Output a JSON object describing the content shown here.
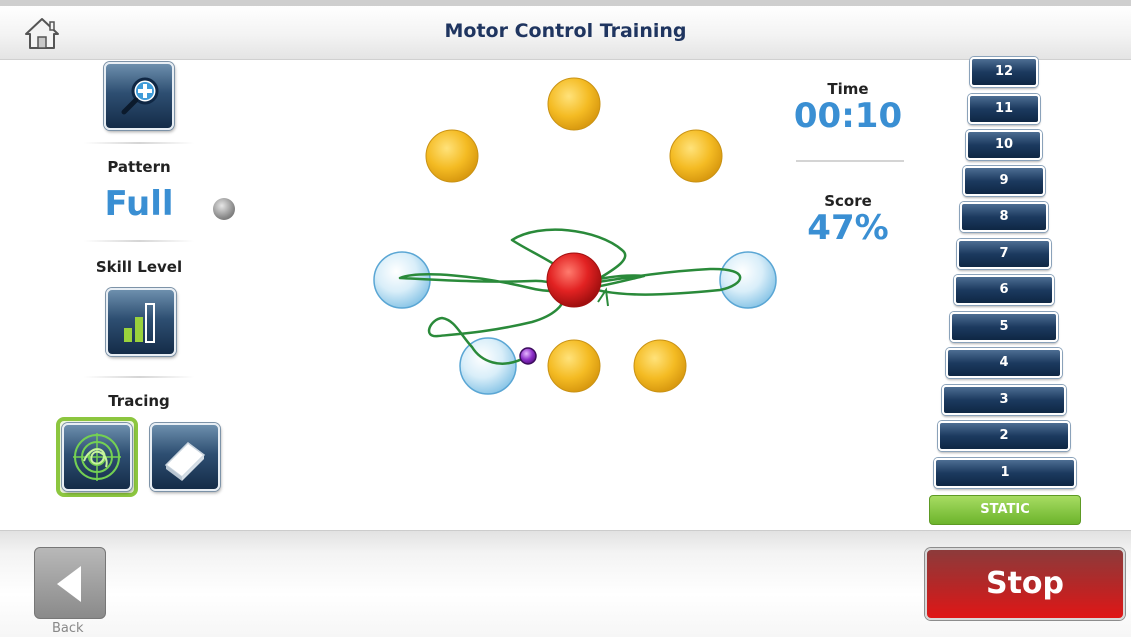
{
  "header": {
    "title": "Motor Control Training",
    "home_icon": "home-icon"
  },
  "left_panel": {
    "zoom_icon": "zoom-in-icon",
    "pattern_label": "Pattern",
    "pattern_value": "Full",
    "skill_label": "Skill Level",
    "skill_icon": "bar-chart-icon",
    "tracing_label": "Tracing",
    "tracing_icon": "target-trace-icon",
    "eraser_icon": "eraser-icon"
  },
  "stats": {
    "time_label": "Time",
    "time_value": "00:10",
    "score_label": "Score",
    "score_value": "47%"
  },
  "levels": [
    "12",
    "11",
    "10",
    "9",
    "8",
    "7",
    "6",
    "5",
    "4",
    "3",
    "2",
    "1"
  ],
  "static_label": "STATIC",
  "footer": {
    "back_label": "Back",
    "stop_label": "Stop"
  },
  "colors": {
    "accent_blue": "#3a8fd3",
    "title_navy": "#1f3560",
    "target_yellow": "#f2b81f",
    "target_red": "#e02020",
    "trace_green": "#2a8a3a",
    "static_green": "#7cc13a",
    "stop_red": "#c42222"
  }
}
